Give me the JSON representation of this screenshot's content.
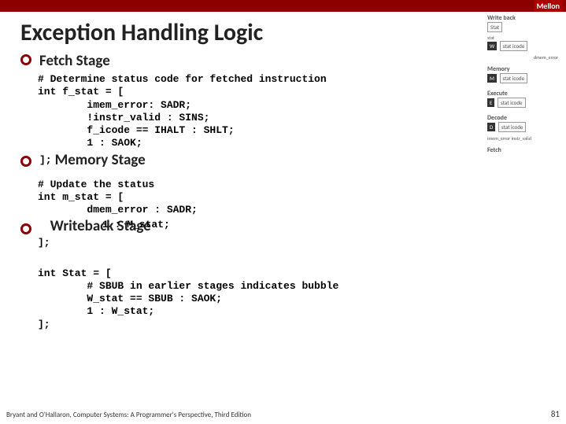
{
  "header": {
    "brand": "Mellon"
  },
  "title": "Exception Handling Logic",
  "stages": {
    "fetch": {
      "name": "Fetch Stage"
    },
    "memory": {
      "name": "Memory Stage"
    },
    "writeback": {
      "name": "Writeback Stage"
    }
  },
  "code": {
    "fetch": "# Determine status code for fetched instruction\nint f_stat = [\n        imem_error: SADR;\n        !instr_valid : SINS;\n        f_icode == IHALT : SHLT;\n        1 : SAOK;",
    "fetch_close": "];",
    "memory": "# Update the status\nint m_stat = [\n        dmem_error : SADR;",
    "memory_overlay": "1 : M_stat;",
    "memory_close": "];",
    "writeback": "int Stat = [\n        # SBUB in earlier stages indicates bubble\n        W_stat == SBUB : SAOK;\n        1 : W_stat;\n];"
  },
  "diagram": {
    "writeback_lbl": "Write back",
    "stat_ov": "Stat",
    "stat": "stat",
    "w": "W",
    "stat_icode": "stat  icode",
    "dmem": "dmem_error",
    "memory_lbl": "Memory",
    "m": "M",
    "execute_lbl": "Execute",
    "e": "E",
    "decode_lbl": "Decode",
    "d": "D",
    "imem": "imem_error instr_valid",
    "fetch_lbl": "Fetch"
  },
  "footer": "Bryant and O'Hallaron, Computer Systems: A Programmer's Perspective, Third Edition",
  "page": "81"
}
